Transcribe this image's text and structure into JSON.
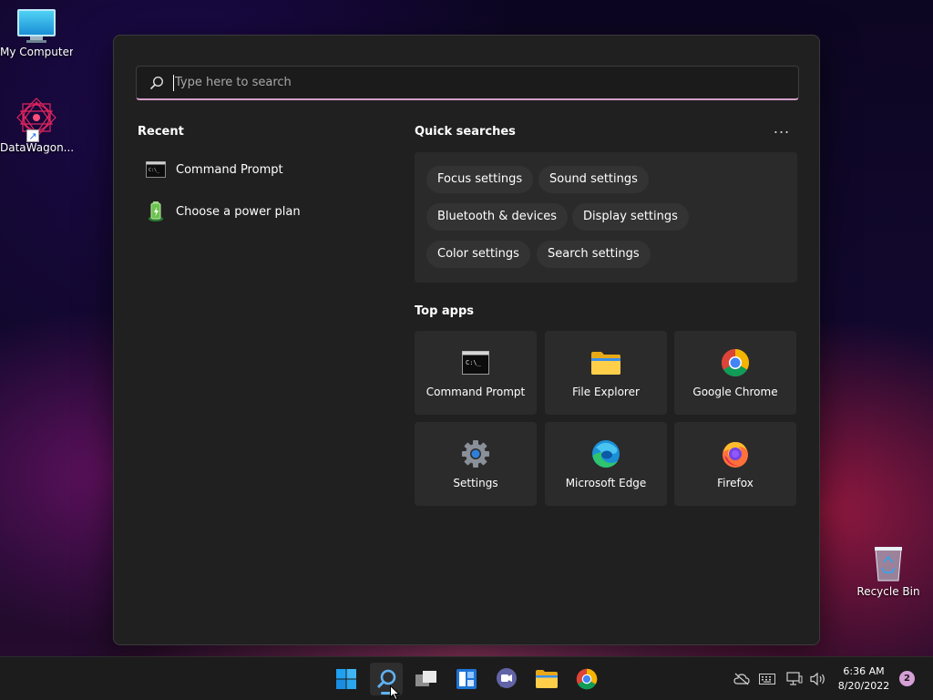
{
  "desktop": {
    "my_computer": "My Computer",
    "datawagon": "DataWagon...",
    "recycle_bin": "Recycle Bin"
  },
  "search": {
    "placeholder": "Type here to search",
    "value": ""
  },
  "recent": {
    "title": "Recent",
    "items": [
      {
        "label": "Command Prompt",
        "icon": "command-prompt-icon"
      },
      {
        "label": "Choose a power plan",
        "icon": "power-plan-icon"
      }
    ]
  },
  "quick_searches": {
    "title": "Quick searches",
    "more": "...",
    "chips": [
      "Focus settings",
      "Sound settings",
      "Bluetooth & devices",
      "Display settings",
      "Color settings",
      "Search settings"
    ]
  },
  "top_apps": {
    "title": "Top apps",
    "apps": [
      {
        "label": "Command Prompt",
        "icon": "command-prompt-icon"
      },
      {
        "label": "File Explorer",
        "icon": "folder-icon"
      },
      {
        "label": "Google Chrome",
        "icon": "chrome-icon"
      },
      {
        "label": "Settings",
        "icon": "gear-icon"
      },
      {
        "label": "Microsoft Edge",
        "icon": "edge-icon"
      },
      {
        "label": "Firefox",
        "icon": "firefox-icon"
      }
    ]
  },
  "taskbar": {
    "time": "6:36 AM",
    "date": "8/20/2022",
    "notifications": "2"
  },
  "colors": {
    "accent_underline": "#d39ec9",
    "taskbar_indicator": "#5fb2f2",
    "badge": "#d6a0d6"
  }
}
